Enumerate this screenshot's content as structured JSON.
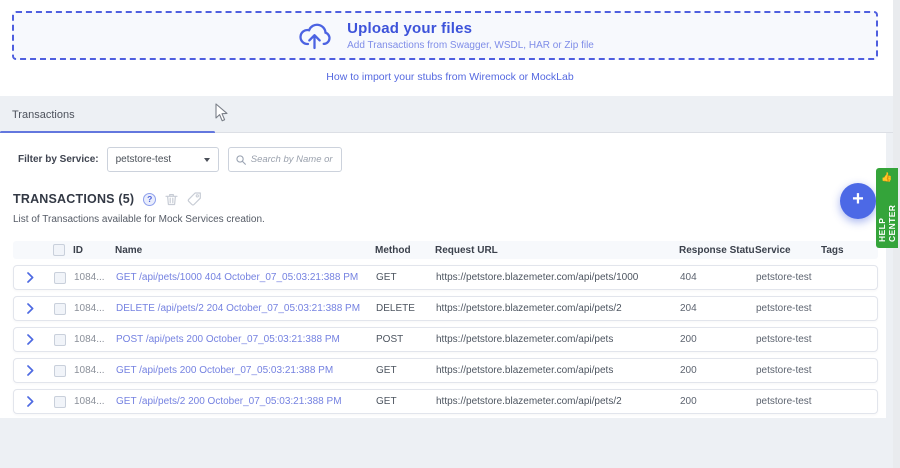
{
  "upload": {
    "title": "Upload your files",
    "subtitle": "Add Transactions from Swagger, WSDL, HAR or Zip file",
    "import_link": "How to import your stubs from Wiremock or MockLab"
  },
  "tabs": {
    "transactions": "Transactions"
  },
  "filter": {
    "label": "Filter by Service:",
    "selected_service": "petstore-test",
    "search_placeholder": "Search by Name or Tag"
  },
  "list": {
    "heading": "TRANSACTIONS (5)",
    "description": "List of Transactions available for Mock Services creation.",
    "columns": [
      "ID",
      "Name",
      "Method",
      "Request URL",
      "Response Status",
      "Service",
      "Tags"
    ],
    "rows": [
      {
        "id": "1084...",
        "name": "GET /api/pets/1000 404 October_07_05:03:21:388 PM",
        "method": "GET",
        "url": "https://petstore.blazemeter.com/api/pets/1000",
        "status": "404",
        "service": "petstore-test",
        "tags": ""
      },
      {
        "id": "1084...",
        "name": "DELETE /api/pets/2 204 October_07_05:03:21:388 PM",
        "method": "DELETE",
        "url": "https://petstore.blazemeter.com/api/pets/2",
        "status": "204",
        "service": "petstore-test",
        "tags": ""
      },
      {
        "id": "1084...",
        "name": "POST /api/pets 200 October_07_05:03:21:388 PM",
        "method": "POST",
        "url": "https://petstore.blazemeter.com/api/pets",
        "status": "200",
        "service": "petstore-test",
        "tags": ""
      },
      {
        "id": "1084...",
        "name": "GET /api/pets 200 October_07_05:03:21:388 PM",
        "method": "GET",
        "url": "https://petstore.blazemeter.com/api/pets",
        "status": "200",
        "service": "petstore-test",
        "tags": ""
      },
      {
        "id": "1084...",
        "name": "GET /api/pets/2 200 October_07_05:03:21:388 PM",
        "method": "GET",
        "url": "https://petstore.blazemeter.com/api/pets/2",
        "status": "200",
        "service": "petstore-test",
        "tags": ""
      }
    ]
  },
  "fab": {
    "label": "+"
  },
  "help_center": {
    "label": "HELP CENTER",
    "emoji": "👍"
  },
  "colors": {
    "accent_blue": "#4c69e6",
    "dashed_border_blue": "#4f5fdf",
    "link_blue": "#7582e1",
    "tab_indicator_blue": "#6377de",
    "help_center_green": "#34a43a",
    "page_background": "#edf0f4"
  }
}
